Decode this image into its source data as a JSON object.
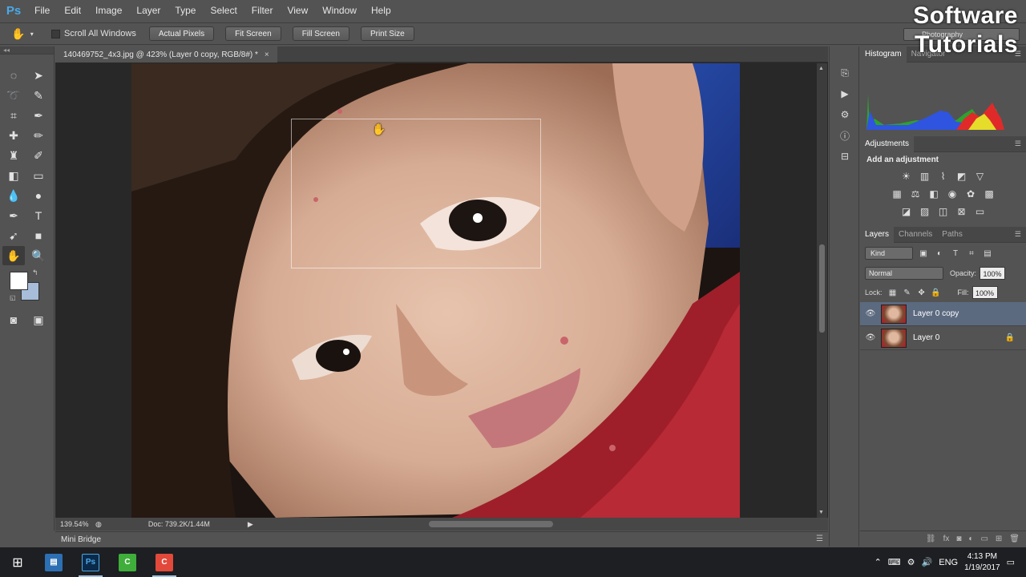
{
  "app": {
    "logo": "Ps"
  },
  "watermark": {
    "line1": "Software",
    "line2": "Tutorials"
  },
  "menu": [
    "File",
    "Edit",
    "Image",
    "Layer",
    "Type",
    "Select",
    "Filter",
    "View",
    "Window",
    "Help"
  ],
  "options": {
    "tool_icon": "hand-icon",
    "scroll_all_label": "Scroll All Windows",
    "scroll_all_checked": false,
    "buttons": [
      "Actual Pixels",
      "Fit Screen",
      "Fill Screen",
      "Print Size"
    ],
    "workspace": "Photography"
  },
  "document": {
    "tab_title": "140469752_4x3.jpg @ 423% (Layer 0 copy, RGB/8#) *",
    "close_glyph": "×"
  },
  "status": {
    "zoom": "139.54%",
    "doc_size": "Doc: 739.2K/1.44M",
    "arrow": "▶"
  },
  "mini_bridge": {
    "label": "Mini Bridge"
  },
  "panels": {
    "top_tabs": [
      "Histogram",
      "Navigator"
    ],
    "adjustments_tab": "Adjustments",
    "adjustments_title": "Add an adjustment",
    "layer_tabs": [
      "Layers",
      "Channels",
      "Paths"
    ],
    "kind_label": "Kind",
    "blend_mode": "Normal",
    "opacity_label": "Opacity:",
    "opacity_value": "100%",
    "lock_label": "Lock:",
    "fill_label": "Fill:",
    "fill_value": "100%",
    "layers": [
      {
        "name": "Layer 0 copy",
        "selected": true,
        "locked": false
      },
      {
        "name": "Layer 0",
        "selected": false,
        "locked": true
      }
    ]
  },
  "taskbar": {
    "apps": [
      "file-explorer",
      "photoshop",
      "camtasia-recorder",
      "camtasia-studio"
    ],
    "language": "ENG",
    "time": "4:13 PM",
    "date": "1/19/2017"
  },
  "colors": {
    "foreground": "#ffffff",
    "background": "#a7bdd9",
    "ps_blue": "#4aa9e8",
    "selected_layer": "#5c6a80"
  }
}
